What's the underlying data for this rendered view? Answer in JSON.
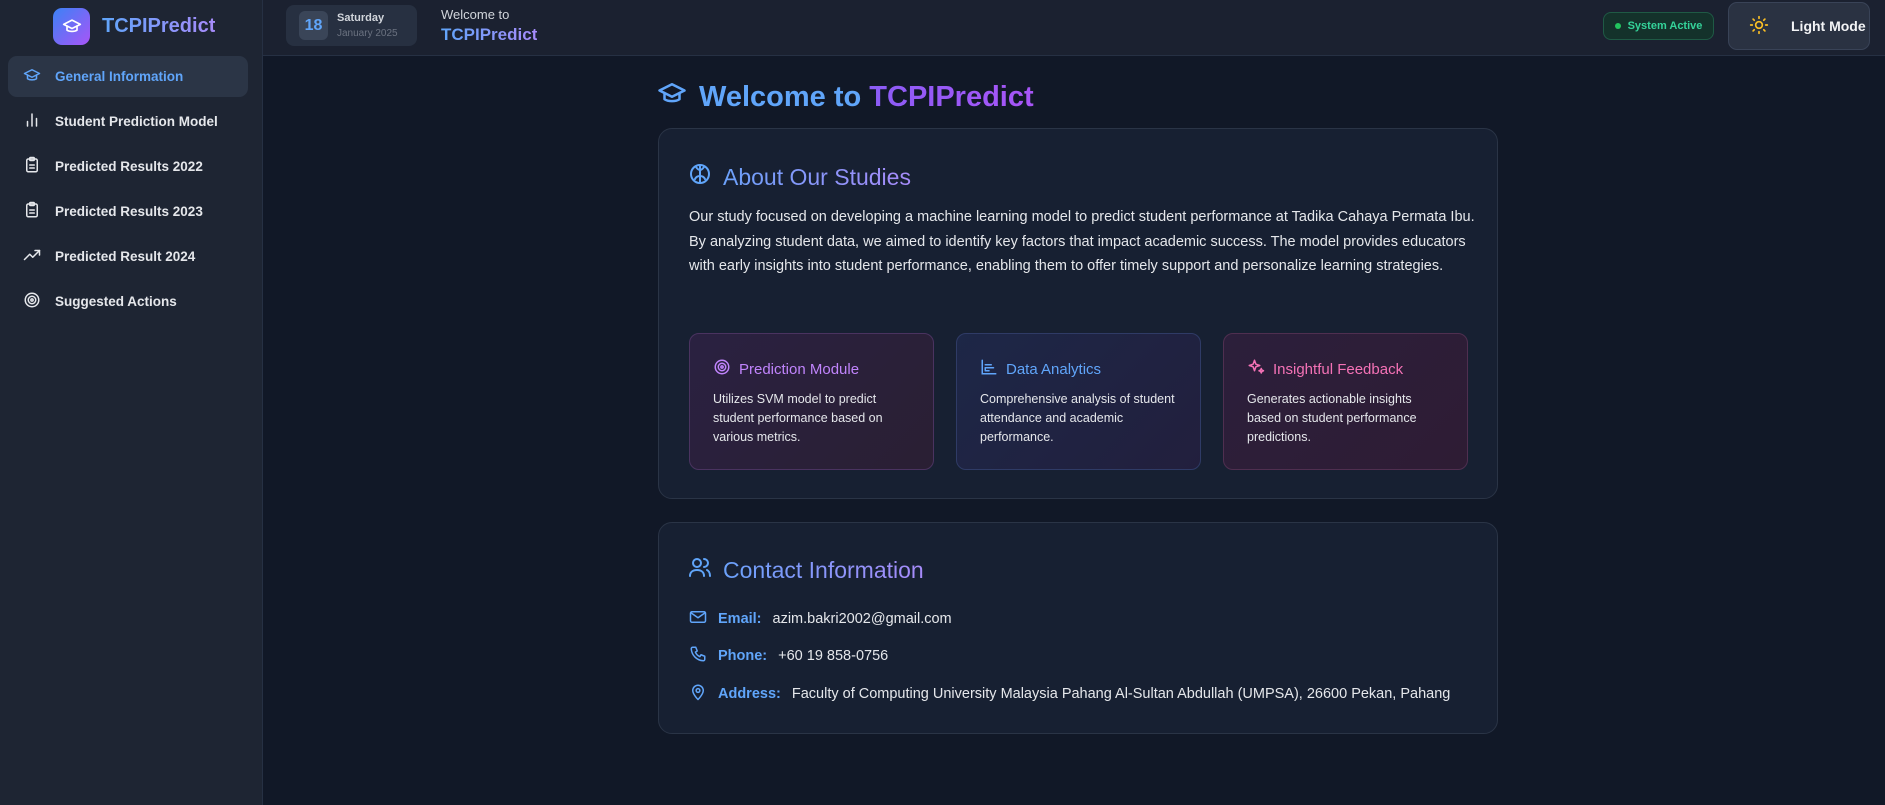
{
  "brand": {
    "name": "TCPIPredict"
  },
  "sidebar": {
    "items": [
      {
        "label": "General Information",
        "icon": "graduation-cap-icon",
        "active": true
      },
      {
        "label": "Student Prediction Model",
        "icon": "bar-chart-icon"
      },
      {
        "label": "Predicted Results 2022",
        "icon": "clipboard-icon"
      },
      {
        "label": "Predicted Results 2023",
        "icon": "clipboard-icon"
      },
      {
        "label": "Predicted Result 2024",
        "icon": "trending-up-icon"
      },
      {
        "label": "Suggested Actions",
        "icon": "target-icon"
      }
    ]
  },
  "header": {
    "date": {
      "day_num": "18",
      "weekday": "Saturday",
      "month_year": "January 2025"
    },
    "welcome_small": "Welcome to",
    "welcome_app": "TCPIPredict",
    "status": "System Active",
    "mode_button": "Light Mode"
  },
  "main": {
    "title_pre": "Welcome to",
    "title_app": "TCPIPredict",
    "about": {
      "heading": "About Our Studies",
      "text": "Our study focused on developing a machine learning model to predict student performance at Tadika Cahaya Permata Ibu. By analyzing student data, we aimed to identify key factors that impact academic success. The model provides educators with early insights into student performance, enabling them to offer timely support and personalize learning strategies.",
      "features": [
        {
          "title": "Prediction Module",
          "desc": "Utilizes SVM model to predict student performance based on various metrics.",
          "icon": "target-icon"
        },
        {
          "title": "Data Analytics",
          "desc": "Comprehensive analysis of student attendance and academic performance.",
          "icon": "chart-icon"
        },
        {
          "title": "Insightful Feedback",
          "desc": "Generates actionable insights based on student performance predictions.",
          "icon": "sparkles-icon"
        }
      ]
    },
    "contact": {
      "heading": "Contact Information",
      "email_label": "Email:",
      "email": "azim.bakri2002@gmail.com",
      "phone_label": "Phone:",
      "phone": "+60 19 858-0756",
      "address_label": "Address:",
      "address": "Faculty of Computing University Malaysia Pahang Al-Sultan Abdullah (UMPSA), 26600 Pekan, Pahang"
    }
  },
  "colors": {
    "accent_blue": "#60a5fa",
    "accent_purple": "#a855f7",
    "accent_pink": "#f472b6",
    "status_green": "#22c55e"
  }
}
